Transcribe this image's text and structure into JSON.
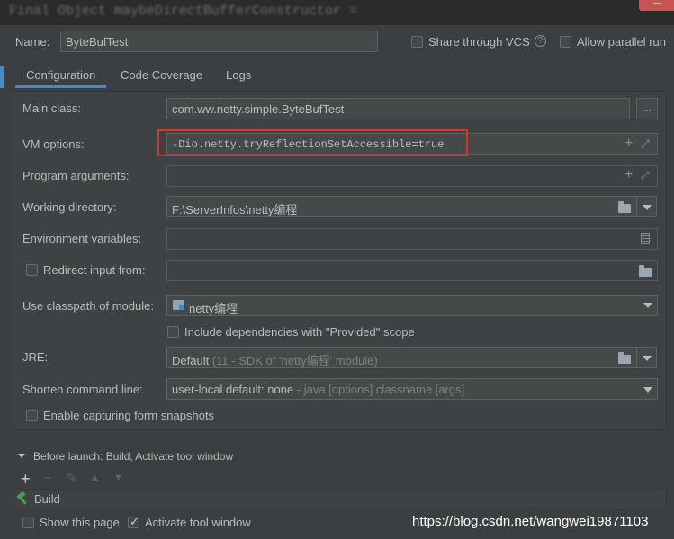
{
  "editor": {
    "code_line": "Final Object maybeDirectBufferConstructor ="
  },
  "header": {
    "name_label": "Name:",
    "name_value": "ByteBufTest",
    "share_vcs_label": "Share through VCS",
    "share_vcs_checked": false,
    "help_icon": "?",
    "allow_parallel_label": "Allow parallel run",
    "allow_parallel_checked": false
  },
  "tabs": [
    {
      "label": "Configuration",
      "active": true
    },
    {
      "label": "Code Coverage",
      "active": false
    },
    {
      "label": "Logs",
      "active": false
    }
  ],
  "config": {
    "main_class_label": "Main class:",
    "main_class_value": "com.ww.netty.simple.ByteBufTest",
    "browse_button": "...",
    "vm_options_label": "VM options:",
    "vm_options_value": "-Dio.netty.tryReflectionSetAccessible=true",
    "program_args_label": "Program arguments:",
    "program_args_value": "",
    "working_dir_label": "Working directory:",
    "working_dir_value": "F:\\ServerInfos\\netty编程",
    "env_vars_label": "Environment variables:",
    "env_vars_value": "",
    "redirect_input_label": "Redirect input from:",
    "redirect_input_checked": false,
    "classpath_label": "Use classpath of module:",
    "classpath_value": "netty编程",
    "include_deps_label": "Include dependencies with \"Provided\" scope",
    "include_deps_checked": false,
    "jre_label": "JRE:",
    "jre_value": "Default",
    "jre_detail": "(11 - SDK of 'netty编程' module)",
    "shorten_label": "Shorten command line:",
    "shorten_value": "user-local default: none",
    "shorten_detail": " - java [options] classname [args]",
    "capture_snapshots_label": "Enable capturing form snapshots",
    "capture_snapshots_checked": false
  },
  "before_launch": {
    "header": "Before launch: Build, Activate tool window",
    "toolbar": [
      "+",
      "−",
      "✎",
      "▲",
      "▼"
    ],
    "items": [
      {
        "label": "Build",
        "icon": "hammer-icon"
      }
    ]
  },
  "footer": {
    "show_page_label": "Show this page",
    "show_page_checked": false,
    "activate_tool_label": "Activate tool window",
    "activate_tool_checked": true
  },
  "watermark": "https://blog.csdn.net/wangwei19871103",
  "colors": {
    "accent": "#4a88c7",
    "highlight": "#e0322d",
    "close": "#c75450",
    "build_icon": "#499c54"
  }
}
